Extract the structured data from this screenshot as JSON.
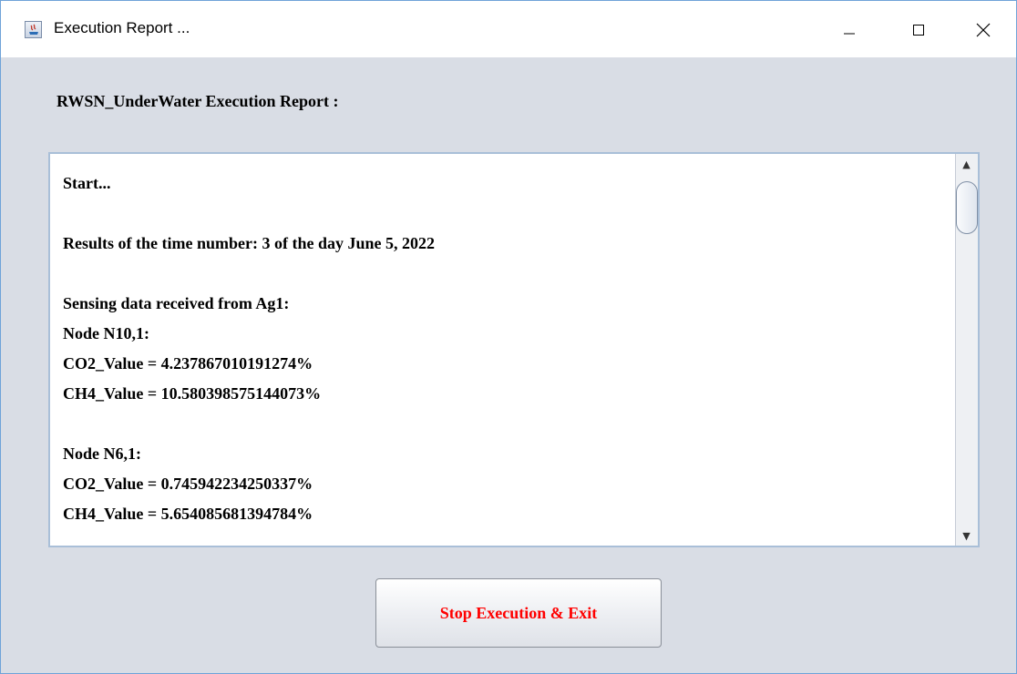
{
  "window": {
    "title": "Execution Report ...",
    "icon": "java-app-icon",
    "controls": [
      "minimize-icon",
      "maximize-icon",
      "close-icon"
    ]
  },
  "report": {
    "heading": "RWSN_UnderWater Execution Report :",
    "lines": [
      "Start...",
      "",
      "Results of the time number: 3 of the day June 5, 2022",
      "",
      "Sensing data received from Ag1:",
      "Node N10,1:",
      "CO2_Value = 4.237867010191274%",
      "CH4_Value = 10.580398575144073%",
      "",
      "Node N6,1:",
      "CO2_Value = 0.745942234250337%",
      "CH4_Value = 5.654085681394784%"
    ]
  },
  "actions": {
    "stop_label": "Stop Execution & Exit"
  },
  "colors": {
    "window_bg": "#d9dde5",
    "border": "#6fa3d8",
    "button_text": "#ff0000"
  }
}
